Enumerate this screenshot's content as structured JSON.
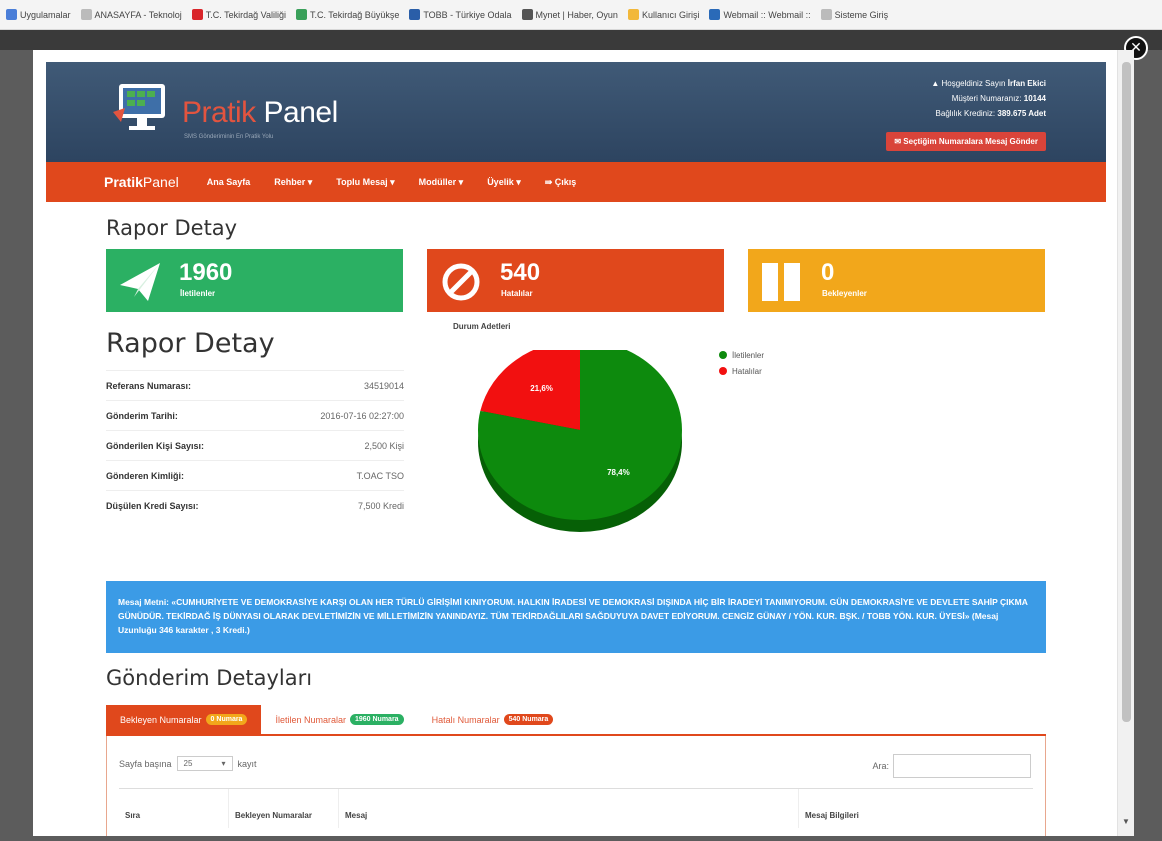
{
  "bookmarks": [
    {
      "label": "Uygulamalar",
      "color": "#4a7ed8"
    },
    {
      "label": "ANASAYFA - Teknoloj",
      "color": "#bbbbbb"
    },
    {
      "label": "T.C. Tekirdağ Valiliği",
      "color": "#d9252a"
    },
    {
      "label": "T.C. Tekirdağ Büyükşe",
      "color": "#3aa05a"
    },
    {
      "label": "TOBB - Türkiye Odala",
      "color": "#2a5ea8"
    },
    {
      "label": "Mynet | Haber, Oyun",
      "color": "#555555"
    },
    {
      "label": "Kullanıcı Girişi",
      "color": "#f2b83a"
    },
    {
      "label": "Webmail :: Webmail ::",
      "color": "#2a6ab8"
    },
    {
      "label": "Sisteme Giriş",
      "color": "#bbbbbb"
    }
  ],
  "header": {
    "logo_part1": "Pratik",
    "logo_part2": " Panel",
    "logo_sub": "SMS Gönderiminin En Pratik Yolu",
    "welcome": "Hoşgeldiniz Sayın",
    "user_name": "İrfan Ekici",
    "customer_no_label": "Müşteri Numaranız:",
    "customer_no": "10144",
    "credit_label": "Bağlılık Krediniz:",
    "credit_value": "389.675 Adet",
    "send_button": "Seçtiğim Numaralara Mesaj Gönder"
  },
  "nav": {
    "brand_bold": "Pratik",
    "brand_light": "Panel",
    "items": [
      "Ana Sayfa",
      "Rehber ▾",
      "Toplu Mesaj ▾",
      "Modüller ▾",
      "Üyelik ▾",
      "⇛ Çıkış"
    ]
  },
  "page_title": "Rapor Detay",
  "stats": [
    {
      "value": "1960",
      "label": "İletilenler",
      "color": "#2bb063",
      "icon": "paper-plane-icon"
    },
    {
      "value": "540",
      "label": "Hatalılar",
      "color": "#e0481c",
      "icon": "ban-icon"
    },
    {
      "value": "0",
      "label": "Bekleyenler",
      "color": "#f2a71b",
      "icon": "pause-icon"
    }
  ],
  "detail_title": "Rapor Detay",
  "details": [
    {
      "key": "Referans Numarası:",
      "value": "34519014"
    },
    {
      "key": "Gönderim Tarihi:",
      "value": "2016-07-16 02:27:00"
    },
    {
      "key": "Gönderilen Kişi Sayısı:",
      "value": "2,500 Kişi"
    },
    {
      "key": "Gönderen Kimliği:",
      "value": "T.OAC TSO"
    },
    {
      "key": "Düşülen Kredi Sayısı:",
      "value": "7,500 Kredi"
    }
  ],
  "chart_data": {
    "type": "pie",
    "title": "Durum Adetleri",
    "categories": [
      "İletilenler",
      "Hatalılar"
    ],
    "values": [
      78.4,
      21.6
    ],
    "labels": [
      "78,4%",
      "21,6%"
    ],
    "colors": [
      "#0d8a0d",
      "#f21010"
    ],
    "legend_position": "top-right"
  },
  "message": {
    "label": "Mesaj Metni:",
    "text": " «CUMHURİYETE VE DEMOKRASİYE KARŞI OLAN HER TÜRLÜ GİRİŞİMİ KINIYORUM. HALKIN İRADESİ VE DEMOKRASİ DIŞINDA HİÇ BİR İRADEYİ TANIMIYORUM. GÜN DEMOKRASİYE VE DEVLETE SAHİP ÇIKMA GÜNÜDÜR. TEKİRDAĞ İŞ DÜNYASI OLARAK DEVLETİMİZİN VE MİLLETİMİZİN YANINDAYIZ. TÜM TEKİRDAĞLILARI SAĞDUYUYA DAVET EDİYORUM. CENGİZ GÜNAY / YÖN. KUR. BŞK. / TOBB YÖN. KUR. ÜYESİ»",
    "meta": " (Mesaj Uzunluğu 346 karakter , 3 Kredi.)"
  },
  "details_title": "Gönderim Detayları",
  "tabs": [
    {
      "label": "Bekleyen Numaralar",
      "badge": "0 Numara",
      "badge_color": "#f2a71b",
      "active": true
    },
    {
      "label": "İletilen Numaralar",
      "badge": "1960 Numara",
      "badge_color": "#2bb063",
      "active": false
    },
    {
      "label": "Hatalı Numaralar",
      "badge": "540 Numara",
      "badge_color": "#e0481c",
      "active": false
    }
  ],
  "table": {
    "per_page_prefix": "Sayfa başına",
    "per_page_value": "25",
    "per_page_suffix": "kayıt",
    "search_label": "Ara:",
    "columns": [
      "Sıra",
      "Bekleyen Numaralar",
      "Mesaj",
      "Mesaj Bilgileri"
    ]
  }
}
